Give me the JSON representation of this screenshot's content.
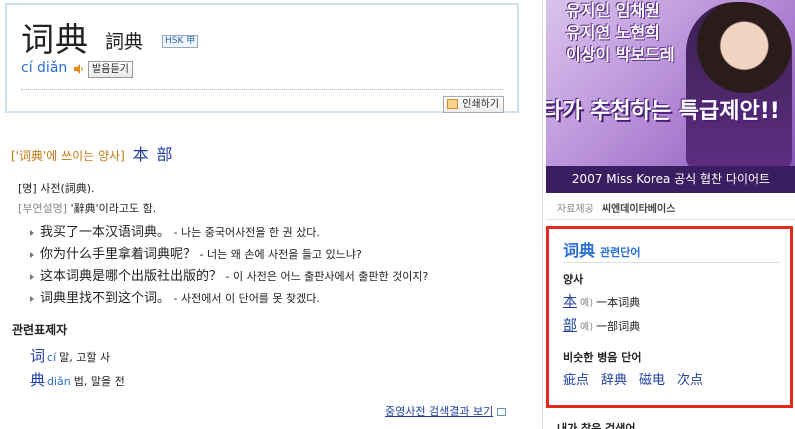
{
  "entry": {
    "word": "词典",
    "traditional": "詞典",
    "hsk": "HSK 甲",
    "pinyin": "cí diǎn",
    "listen_label": "발음듣기",
    "print_label": "인쇄하기"
  },
  "measure": {
    "title": "['词典'에 쓰이는 양사]",
    "links": [
      "本",
      "部"
    ]
  },
  "definition": {
    "pos_line": "[명] 사전(詞典).",
    "note_label": "[부연설명]",
    "note_text": "'辭典'이라고도 함.",
    "examples": [
      {
        "zh": "我买了一本汉语词典。",
        "ko": " - 나는 중국어사전을 한 권 샀다."
      },
      {
        "zh": "你为什么手里拿着词典呢？",
        "ko": " - 너는 왜 손에 사전을 들고 있느냐?"
      },
      {
        "zh": "这本词典是哪个出版社出版的？",
        "ko": " - 이 사전은 어느 출판사에서 출판한 것이지?"
      },
      {
        "zh": "词典里找不到这个词。",
        "ko": " - 사전에서 이 단어를 못 찾겠다."
      }
    ]
  },
  "related": {
    "title": "관련표제자",
    "items": [
      {
        "ch": "词",
        "py": "cí",
        "meaning": "말, 고할 사"
      },
      {
        "ch": "典",
        "py": "diǎn",
        "meaning": "법, 말을 전"
      }
    ],
    "result_link": "중영사전 검색결과 보기"
  },
  "ad": {
    "lines": [
      "유지인 임채원",
      "유지연 노현희",
      "이상이 박보드레"
    ],
    "slogan": "타가 추천하는 특급제안!!",
    "caption": "2007 Miss Korea 공식 협찬 다이어트"
  },
  "source": {
    "label": "자료제공",
    "provider": "씨엔데이타베이스"
  },
  "related_box": {
    "word": "词典",
    "title": "관련단어",
    "measure_title": "양사",
    "measures": [
      {
        "ch": "本",
        "eg": "예)",
        "example": "一本词典"
      },
      {
        "ch": "部",
        "eg": "예)",
        "example": "一部词典"
      }
    ],
    "similar_title": "비슷한 병음 단어",
    "similar": [
      "疵点",
      "辞典",
      "磁电",
      "次点"
    ]
  },
  "next_section": "내가 찾은 검색어"
}
